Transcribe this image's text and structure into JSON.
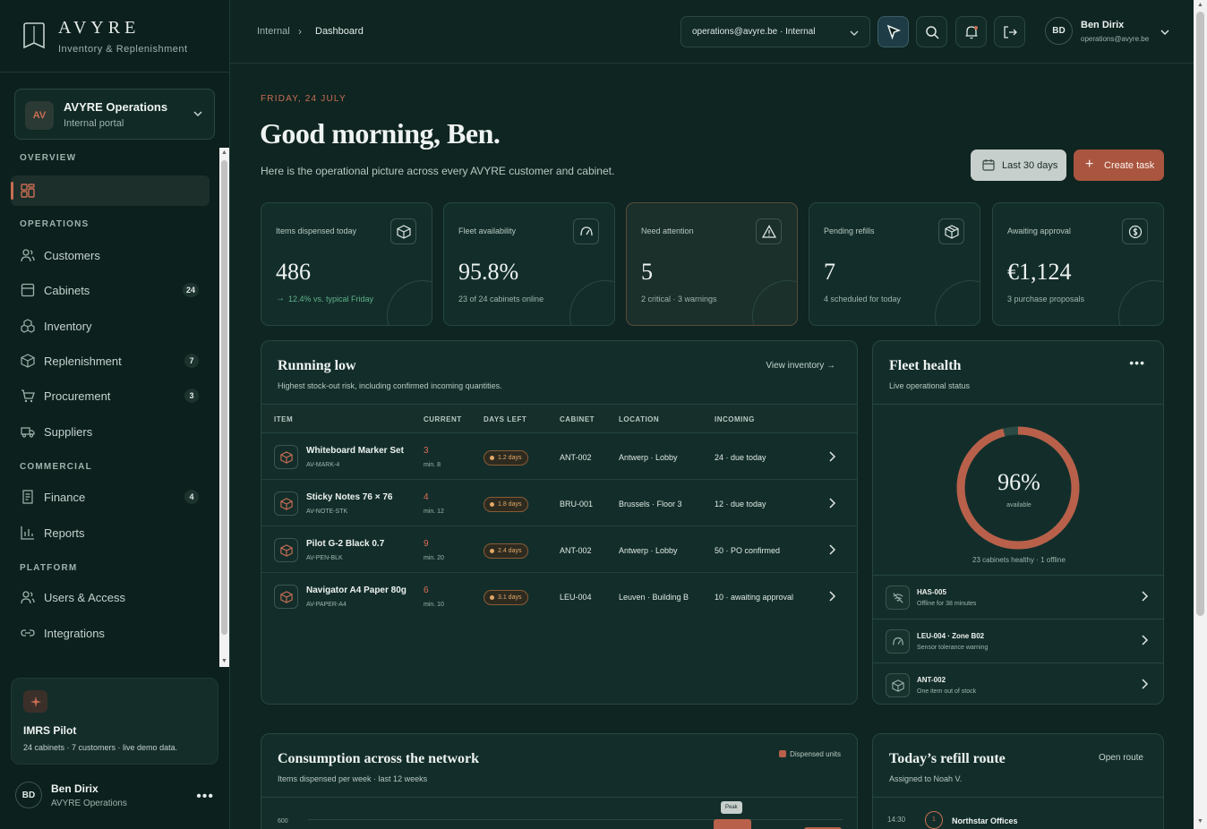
{
  "brand": {
    "name": "AVYRE",
    "tagline": "Inventory & Replenishment"
  },
  "org": {
    "initials": "AV",
    "name": "AVYRE Operations",
    "sub": "Internal portal"
  },
  "nav": {
    "overview": "OVERVIEW",
    "operations": "OPERATIONS",
    "commercial": "COMMERCIAL",
    "platform": "PLATFORM",
    "items": {
      "customers": {
        "label": "Customers"
      },
      "cabinets": {
        "label": "Cabinets",
        "badge": "24"
      },
      "inventory": {
        "label": "Inventory"
      },
      "replenishment": {
        "label": "Replenishment",
        "badge": "7"
      },
      "procurement": {
        "label": "Procurement",
        "badge": "3"
      },
      "suppliers": {
        "label": "Suppliers"
      },
      "finance": {
        "label": "Finance",
        "badge": "4"
      },
      "reports": {
        "label": "Reports"
      },
      "users": {
        "label": "Users & Access"
      },
      "integrations": {
        "label": "Integrations"
      }
    }
  },
  "pilot": {
    "title": "IMRS Pilot",
    "desc": "24 cabinets · 7 customers · live demo data."
  },
  "footer_user": {
    "initials": "BD",
    "name": "Ben Dirix",
    "org": "AVYRE Operations"
  },
  "breadcrumb": {
    "parent": "Internal",
    "current": "Dashboard"
  },
  "tenant_select": {
    "value": "operations@avyre.be · Internal"
  },
  "header_user": {
    "initials": "BD",
    "name": "Ben Dirix",
    "email": "operations@avyre.be"
  },
  "page": {
    "date": "FRIDAY, 24 JULY",
    "greeting": "Good morning, Ben.",
    "subtitle": "Here is the operational picture across every AVYRE customer and cabinet.",
    "range_button": "Last 30 days",
    "create_button": "Create task"
  },
  "kpis": [
    {
      "label": "Items dispensed today",
      "value": "486",
      "note": "12.4% vs. typical Friday"
    },
    {
      "label": "Fleet availability",
      "value": "95.8%",
      "note": "23 of 24 cabinets online"
    },
    {
      "label": "Need attention",
      "value": "5",
      "note": "2 critical · 3 warnings"
    },
    {
      "label": "Pending refills",
      "value": "7",
      "note": "4 scheduled for today"
    },
    {
      "label": "Awaiting approval",
      "value": "€1,124",
      "note": "3 purchase proposals"
    }
  ],
  "running_low": {
    "title": "Running low",
    "subtitle": "Highest stock-out risk, including confirmed incoming quantities.",
    "link": "View inventory",
    "columns": [
      "ITEM",
      "CURRENT",
      "DAYS LEFT",
      "CABINET",
      "LOCATION",
      "INCOMING"
    ],
    "rows": [
      {
        "name": "Whiteboard Marker Set",
        "sku": "AV-MARK-4",
        "current": "3",
        "min": "min. 8",
        "days": "1.2 days",
        "cabinet": "ANT-002",
        "location": "Antwerp · Lobby",
        "incoming": "24 · due today"
      },
      {
        "name": "Sticky Notes 76 × 76",
        "sku": "AV-NOTE-STK",
        "current": "4",
        "min": "min. 12",
        "days": "1.8 days",
        "cabinet": "BRU-001",
        "location": "Brussels · Floor 3",
        "incoming": "12 · due today"
      },
      {
        "name": "Pilot G-2 Black 0.7",
        "sku": "AV-PEN-BLK",
        "current": "9",
        "min": "min. 20",
        "days": "2.4 days",
        "cabinet": "ANT-002",
        "location": "Antwerp · Lobby",
        "incoming": "50 · PO confirmed"
      },
      {
        "name": "Navigator A4 Paper 80g",
        "sku": "AV-PAPER-A4",
        "current": "6",
        "min": "min. 10",
        "days": "3.1 days",
        "cabinet": "LEU-004",
        "location": "Leuven · Building B",
        "incoming": "10 · awaiting approval"
      }
    ]
  },
  "fleet": {
    "title": "Fleet health",
    "subtitle": "Live operational status",
    "percent": "96%",
    "percent_value": 0.96,
    "percent_label": "available",
    "summary": "23 cabinets healthy · 1 offline",
    "alerts": [
      {
        "title": "HAS-005",
        "desc": "Offline for 38 minutes"
      },
      {
        "title": "LEU-004 · Zone B02",
        "desc": "Sensor tolerance warning"
      },
      {
        "title": "ANT-002",
        "desc": "One item out of stock"
      }
    ]
  },
  "consumption": {
    "title": "Consumption across the network",
    "subtitle": "Items dispensed per week · last 12 weeks",
    "legend": "Dispensed units",
    "tick": "600",
    "peak": "Peak"
  },
  "route": {
    "title": "Today’s refill route",
    "link": "Open route",
    "subtitle": "Assigned to Noah V.",
    "stops": [
      {
        "time": "14:30",
        "num": "1",
        "name": "Northstar Offices"
      }
    ]
  },
  "colors": {
    "accent": "#c86d53",
    "background": "#0f2521",
    "card": "#132e2a",
    "success": "#5fb08b",
    "warning": "#e2a767"
  }
}
